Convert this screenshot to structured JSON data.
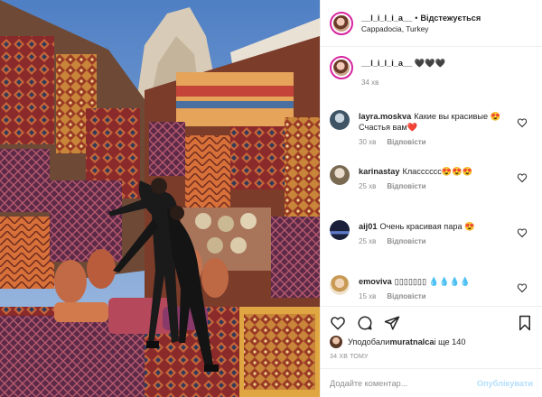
{
  "header": {
    "username": "__l_i_l_i_a__",
    "dot": "•",
    "follow_state": "Відстежується",
    "location": "Cappadocia, Turkey"
  },
  "caption": {
    "username": "__l_i_l_i_a__",
    "text": "🖤🖤🖤",
    "time": "34 хв"
  },
  "comments": [
    {
      "username": "layra.moskva",
      "text": "Какие вы красивые 😍 Счастья вам❤️",
      "time": "30 хв",
      "reply": "Відповісти"
    },
    {
      "username": "karinastay",
      "text": "Класссссс😍😍😍",
      "time": "25 хв",
      "reply": "Відповісти"
    },
    {
      "username": "aij01",
      "text": "Очень красивая пара 😍",
      "time": "25 хв",
      "reply": "Відповісти"
    },
    {
      "username": "emoviva",
      "text": "▯▯▯▯▯▯▯ 💧💧💧💧",
      "time": "15 хв",
      "reply": "Відповісти"
    }
  ],
  "likes": {
    "prefix": "Уподобали ",
    "username": "muratnalca",
    "suffix": " і ще 140"
  },
  "post_time": "34 ХВ ТОМУ",
  "add_comment": {
    "placeholder": "Додайте коментар...",
    "publish": "Опублікувати"
  },
  "icons": {
    "like": "heart-icon",
    "comment": "comment-icon",
    "share": "share-icon",
    "save": "bookmark-icon"
  },
  "colors": {
    "follow_ring": "#d6249f",
    "publish_disabled": "#b2dffc",
    "meta_grey": "#8e8e8e"
  }
}
